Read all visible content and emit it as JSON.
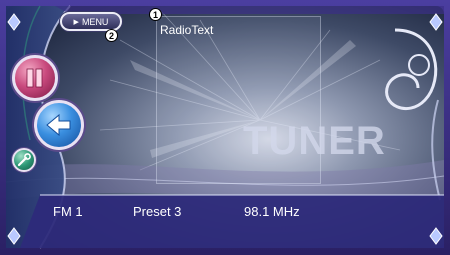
{
  "screen": {
    "menu_label": "MENU",
    "radio_text": "RadioText",
    "source_title": "TUNER",
    "band": "FM 1",
    "preset": "Preset 3",
    "frequency": "98.1 MHz"
  },
  "callouts": [
    "1",
    "2"
  ],
  "colors": {
    "frame": "#3b2f86",
    "bezel_accent": "#2f9e7e",
    "text": "#ffffff"
  },
  "icons": {
    "pause": "pause-icon",
    "back": "back-arrow-icon",
    "setup": "wrench-icon",
    "scroll_up": "arrow-up-icon",
    "scroll_down": "arrow-down-icon",
    "scroll": "swirl-icon"
  }
}
